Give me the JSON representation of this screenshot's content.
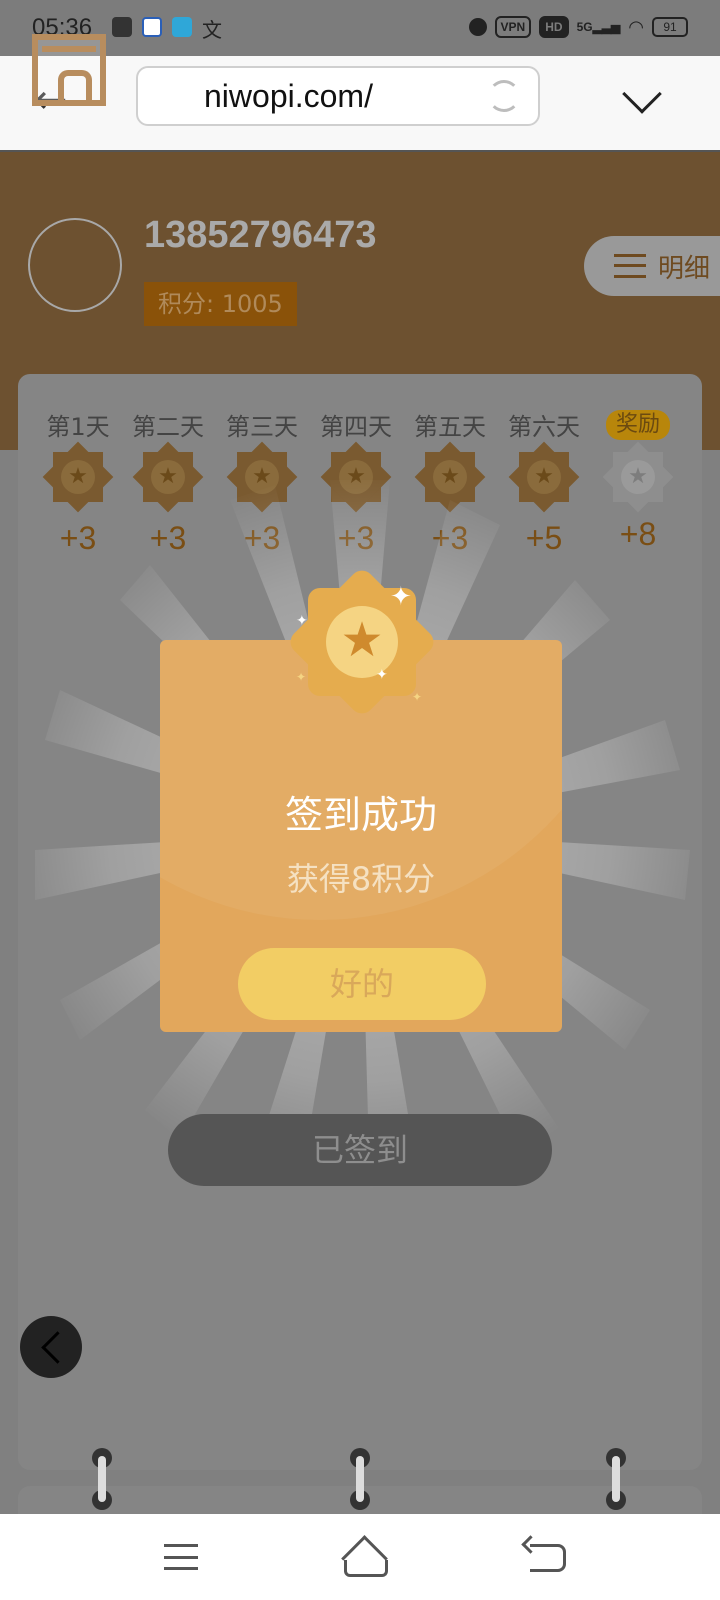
{
  "status_bar": {
    "time": "05:36",
    "vpn": "VPN",
    "hd": "HD",
    "network": "5G",
    "battery": "91"
  },
  "browser": {
    "url": "niwopi.com/"
  },
  "profile": {
    "phone": "13852796473",
    "points_label": "积分: 1005",
    "detail_label": "明细"
  },
  "checkin": {
    "days": [
      {
        "label": "第1天",
        "value": "+3"
      },
      {
        "label": "第二天",
        "value": "+3"
      },
      {
        "label": "第三天",
        "value": "+3"
      },
      {
        "label": "第四天",
        "value": "+3"
      },
      {
        "label": "第五天",
        "value": "+3"
      },
      {
        "label": "第六天",
        "value": "+5"
      },
      {
        "label": "奖励",
        "value": "+8"
      }
    ],
    "signed_label": "已签到"
  },
  "dialog": {
    "title": "签到成功",
    "subtitle": "获得8积分",
    "ok_label": "好的"
  },
  "colors": {
    "accent": "#e2a75c",
    "header": "#6d5130",
    "button_yellow": "#f2cd64"
  }
}
